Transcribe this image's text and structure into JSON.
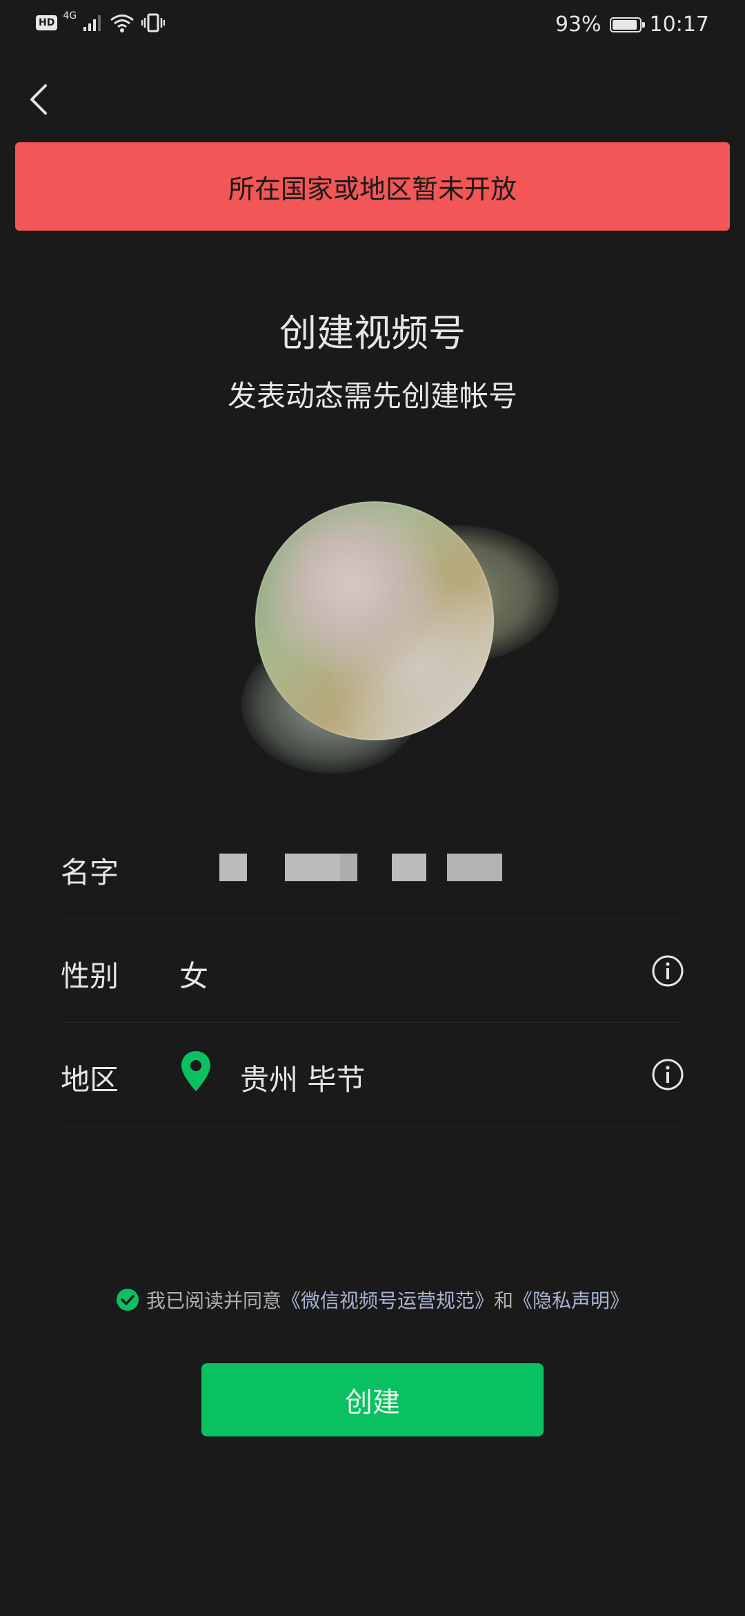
{
  "status_bar": {
    "hd": "HD",
    "network": "4G",
    "battery_percent": "93%",
    "battery_level": 0.93,
    "time": "10:17"
  },
  "navigation": {
    "back_icon": "chevron-left-icon"
  },
  "alert": {
    "text": "所在国家或地区暂未开放",
    "color": "#f25656"
  },
  "header": {
    "title": "创建视频号",
    "subtitle": "发表动态需先创建帐号"
  },
  "form": {
    "name": {
      "label": "名字"
    },
    "gender": {
      "label": "性别",
      "value": "女",
      "info_icon": "info-icon"
    },
    "region": {
      "label": "地区",
      "value": "贵州 毕节",
      "location_icon": "location-pin-icon",
      "info_icon": "info-icon"
    }
  },
  "agreement": {
    "prefix": "我已阅读并同意",
    "link1": "《微信视频号运营规范》",
    "middle": "和",
    "link2": "《隐私声明》",
    "checked": true
  },
  "actions": {
    "create_label": "创建",
    "accent": "#09c160"
  }
}
